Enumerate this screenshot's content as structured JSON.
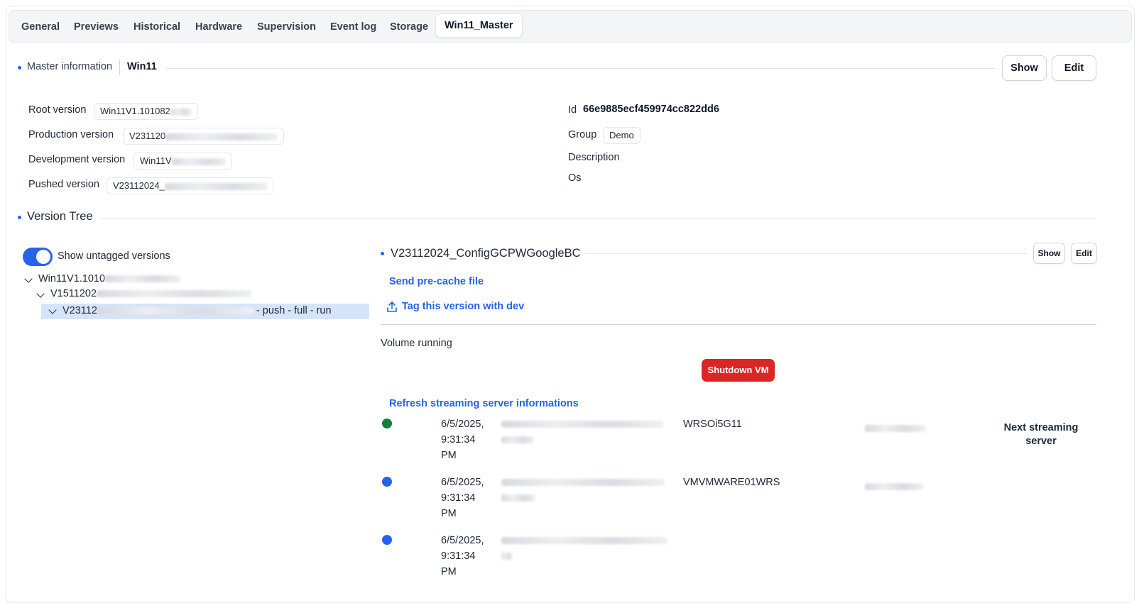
{
  "tabs": [
    "General",
    "Previews",
    "Historical",
    "Hardware",
    "Supervision",
    "Event log",
    "Storage",
    "Win11_Master"
  ],
  "active_tab": "Win11_Master",
  "master": {
    "section_label": "Master information",
    "name": "Win11",
    "show_label": "Show",
    "edit_label": "Edit"
  },
  "fields_left": [
    {
      "label": "Root version",
      "value": "Win11V1.101082"
    },
    {
      "label": "Production version",
      "value": "V231120"
    },
    {
      "label": "Development version",
      "value": "Win11V"
    },
    {
      "label": "Pushed version",
      "value": "V23112024_"
    }
  ],
  "fields_right": {
    "id_label": "Id",
    "id_value": "66e9885ecf459974cc822dd6",
    "group_label": "Group",
    "group_value": "Demo",
    "description_label": "Description",
    "os_label": "Os"
  },
  "version_tree": {
    "title": "Version Tree",
    "toggle_label": "Show untagged versions",
    "toggle_on": true,
    "nodes": [
      {
        "text": "Win11V1.1010"
      },
      {
        "text": "V1511202"
      },
      {
        "text": "V23112",
        "suffix": "- push - full - run"
      }
    ]
  },
  "selected_version": {
    "title": "V23112024_ConfigGCPWGoogleBC",
    "show_label": "Show",
    "edit_label": "Edit",
    "send_precache": "Send pre-cache file",
    "tag_action": "Tag this version with dev",
    "volume_status": "Volume running",
    "shutdown_label": "Shutdown VM",
    "refresh_label": "Refresh streaming server informations",
    "next_server_label": "Next streaming server",
    "servers": [
      {
        "status_color": "#15803d",
        "date": "6/5/2025,",
        "time": "9:31:34",
        "ampm": "PM",
        "name": "WRSOi5G11"
      },
      {
        "status_color": "#2563eb",
        "date": "6/5/2025,",
        "time": "9:31:34",
        "ampm": "PM",
        "name": "VMVMWARE01WRS"
      },
      {
        "status_color": "#2563eb",
        "date": "6/5/2025,",
        "time": "9:31:34",
        "ampm": "PM",
        "name": ""
      }
    ]
  },
  "colors": {
    "accent": "#2563eb",
    "danger": "#dc2626",
    "online": "#15803d"
  }
}
